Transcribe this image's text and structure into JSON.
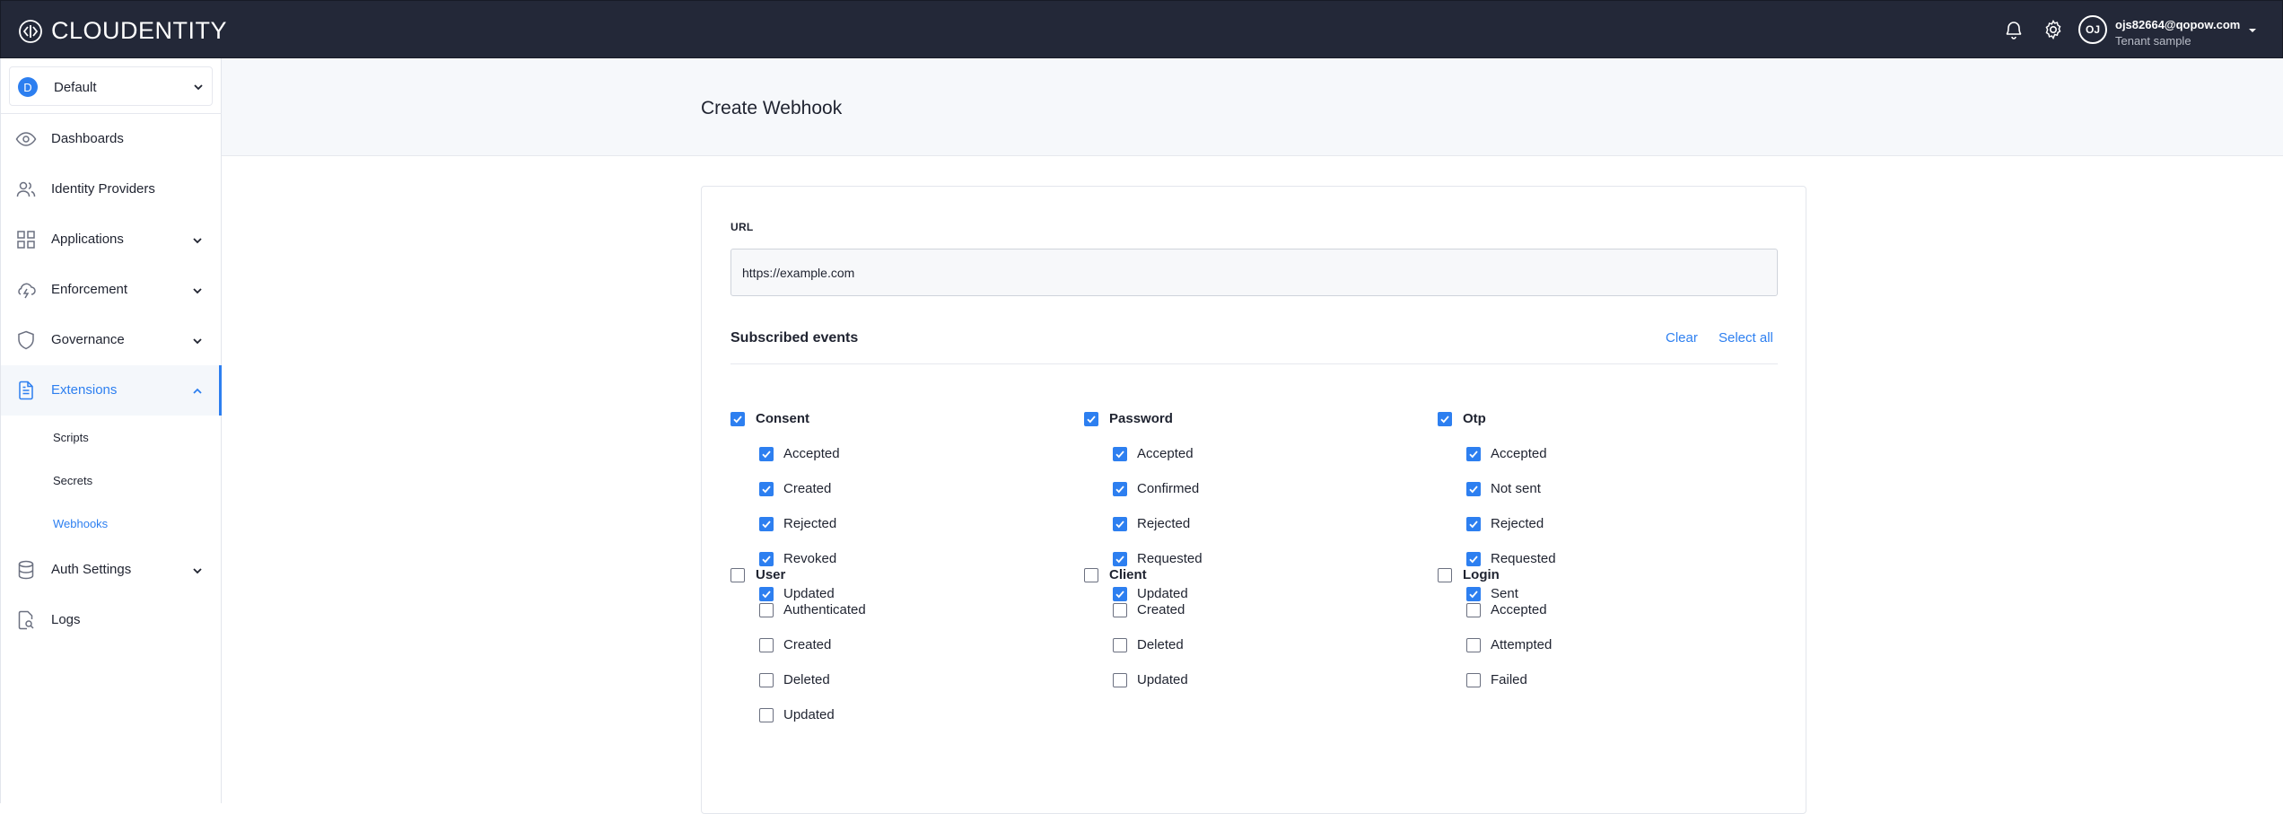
{
  "app": {
    "brand": "CLOUDENTITY"
  },
  "topbar": {
    "icons": [
      "bell-icon",
      "gear-icon"
    ],
    "user": {
      "initials": "OJ",
      "email": "ojs82664@qopow.com",
      "tenant": "Tenant sample"
    }
  },
  "sidebar": {
    "workspace": {
      "badge": "D",
      "name": "Default"
    },
    "items": [
      {
        "label": "Dashboards",
        "icon": "eye-icon"
      },
      {
        "label": "Identity Providers",
        "icon": "users-icon"
      },
      {
        "label": "Applications",
        "icon": "grid-icon"
      },
      {
        "label": "Enforcement",
        "icon": "cloud-lightning-icon"
      },
      {
        "label": "Governance",
        "icon": "shield-icon"
      },
      {
        "label": "Extensions",
        "icon": "file-text-icon"
      },
      {
        "label": "Auth Settings",
        "icon": "database-icon"
      },
      {
        "label": "Logs",
        "icon": "file-search-icon"
      }
    ],
    "sub_items": [
      "Scripts",
      "Secrets",
      "Webhooks"
    ]
  },
  "page": {
    "title": "Create Webhook"
  },
  "form": {
    "url_label": "URL",
    "url_value": "https://example.com",
    "subscribed_title": "Subscribed events",
    "clear_label": "Clear",
    "select_all_label": "Select all"
  },
  "event_groups": [
    {
      "name": "Consent",
      "checked": true,
      "events": [
        "Accepted",
        "Created",
        "Rejected",
        "Revoked",
        "Updated"
      ]
    },
    {
      "name": "Password",
      "checked": true,
      "events": [
        "Accepted",
        "Confirmed",
        "Rejected",
        "Requested",
        "Updated"
      ]
    },
    {
      "name": "Otp",
      "checked": true,
      "events": [
        "Accepted",
        "Not sent",
        "Rejected",
        "Requested",
        "Sent"
      ]
    },
    {
      "name": "User",
      "checked": false,
      "events": [
        "Authenticated",
        "Created",
        "Deleted",
        "Updated"
      ]
    },
    {
      "name": "Client",
      "checked": false,
      "events": [
        "Created",
        "Deleted",
        "Updated"
      ]
    },
    {
      "name": "Login",
      "checked": false,
      "events": [
        "Accepted",
        "Attempted",
        "Failed"
      ]
    }
  ],
  "colors": {
    "topbar": "#232838",
    "accent": "#2d7ff0"
  }
}
